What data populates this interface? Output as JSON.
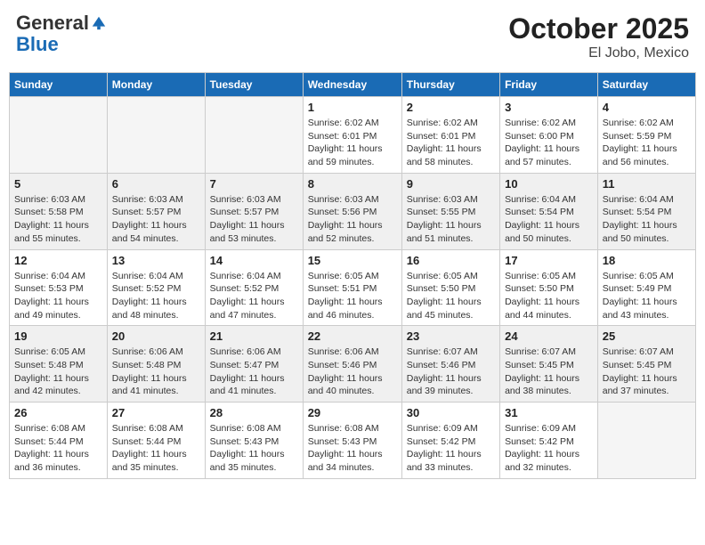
{
  "header": {
    "logo_general": "General",
    "logo_blue": "Blue",
    "month": "October 2025",
    "location": "El Jobo, Mexico"
  },
  "days_of_week": [
    "Sunday",
    "Monday",
    "Tuesday",
    "Wednesday",
    "Thursday",
    "Friday",
    "Saturday"
  ],
  "weeks": [
    [
      {
        "day": "",
        "sunrise": "",
        "sunset": "",
        "daylight": "",
        "empty": true
      },
      {
        "day": "",
        "sunrise": "",
        "sunset": "",
        "daylight": "",
        "empty": true
      },
      {
        "day": "",
        "sunrise": "",
        "sunset": "",
        "daylight": "",
        "empty": true
      },
      {
        "day": "1",
        "sunrise": "Sunrise: 6:02 AM",
        "sunset": "Sunset: 6:01 PM",
        "daylight": "Daylight: 11 hours and 59 minutes.",
        "empty": false
      },
      {
        "day": "2",
        "sunrise": "Sunrise: 6:02 AM",
        "sunset": "Sunset: 6:01 PM",
        "daylight": "Daylight: 11 hours and 58 minutes.",
        "empty": false
      },
      {
        "day": "3",
        "sunrise": "Sunrise: 6:02 AM",
        "sunset": "Sunset: 6:00 PM",
        "daylight": "Daylight: 11 hours and 57 minutes.",
        "empty": false
      },
      {
        "day": "4",
        "sunrise": "Sunrise: 6:02 AM",
        "sunset": "Sunset: 5:59 PM",
        "daylight": "Daylight: 11 hours and 56 minutes.",
        "empty": false
      }
    ],
    [
      {
        "day": "5",
        "sunrise": "Sunrise: 6:03 AM",
        "sunset": "Sunset: 5:58 PM",
        "daylight": "Daylight: 11 hours and 55 minutes.",
        "empty": false
      },
      {
        "day": "6",
        "sunrise": "Sunrise: 6:03 AM",
        "sunset": "Sunset: 5:57 PM",
        "daylight": "Daylight: 11 hours and 54 minutes.",
        "empty": false
      },
      {
        "day": "7",
        "sunrise": "Sunrise: 6:03 AM",
        "sunset": "Sunset: 5:57 PM",
        "daylight": "Daylight: 11 hours and 53 minutes.",
        "empty": false
      },
      {
        "day": "8",
        "sunrise": "Sunrise: 6:03 AM",
        "sunset": "Sunset: 5:56 PM",
        "daylight": "Daylight: 11 hours and 52 minutes.",
        "empty": false
      },
      {
        "day": "9",
        "sunrise": "Sunrise: 6:03 AM",
        "sunset": "Sunset: 5:55 PM",
        "daylight": "Daylight: 11 hours and 51 minutes.",
        "empty": false
      },
      {
        "day": "10",
        "sunrise": "Sunrise: 6:04 AM",
        "sunset": "Sunset: 5:54 PM",
        "daylight": "Daylight: 11 hours and 50 minutes.",
        "empty": false
      },
      {
        "day": "11",
        "sunrise": "Sunrise: 6:04 AM",
        "sunset": "Sunset: 5:54 PM",
        "daylight": "Daylight: 11 hours and 50 minutes.",
        "empty": false
      }
    ],
    [
      {
        "day": "12",
        "sunrise": "Sunrise: 6:04 AM",
        "sunset": "Sunset: 5:53 PM",
        "daylight": "Daylight: 11 hours and 49 minutes.",
        "empty": false
      },
      {
        "day": "13",
        "sunrise": "Sunrise: 6:04 AM",
        "sunset": "Sunset: 5:52 PM",
        "daylight": "Daylight: 11 hours and 48 minutes.",
        "empty": false
      },
      {
        "day": "14",
        "sunrise": "Sunrise: 6:04 AM",
        "sunset": "Sunset: 5:52 PM",
        "daylight": "Daylight: 11 hours and 47 minutes.",
        "empty": false
      },
      {
        "day": "15",
        "sunrise": "Sunrise: 6:05 AM",
        "sunset": "Sunset: 5:51 PM",
        "daylight": "Daylight: 11 hours and 46 minutes.",
        "empty": false
      },
      {
        "day": "16",
        "sunrise": "Sunrise: 6:05 AM",
        "sunset": "Sunset: 5:50 PM",
        "daylight": "Daylight: 11 hours and 45 minutes.",
        "empty": false
      },
      {
        "day": "17",
        "sunrise": "Sunrise: 6:05 AM",
        "sunset": "Sunset: 5:50 PM",
        "daylight": "Daylight: 11 hours and 44 minutes.",
        "empty": false
      },
      {
        "day": "18",
        "sunrise": "Sunrise: 6:05 AM",
        "sunset": "Sunset: 5:49 PM",
        "daylight": "Daylight: 11 hours and 43 minutes.",
        "empty": false
      }
    ],
    [
      {
        "day": "19",
        "sunrise": "Sunrise: 6:05 AM",
        "sunset": "Sunset: 5:48 PM",
        "daylight": "Daylight: 11 hours and 42 minutes.",
        "empty": false
      },
      {
        "day": "20",
        "sunrise": "Sunrise: 6:06 AM",
        "sunset": "Sunset: 5:48 PM",
        "daylight": "Daylight: 11 hours and 41 minutes.",
        "empty": false
      },
      {
        "day": "21",
        "sunrise": "Sunrise: 6:06 AM",
        "sunset": "Sunset: 5:47 PM",
        "daylight": "Daylight: 11 hours and 41 minutes.",
        "empty": false
      },
      {
        "day": "22",
        "sunrise": "Sunrise: 6:06 AM",
        "sunset": "Sunset: 5:46 PM",
        "daylight": "Daylight: 11 hours and 40 minutes.",
        "empty": false
      },
      {
        "day": "23",
        "sunrise": "Sunrise: 6:07 AM",
        "sunset": "Sunset: 5:46 PM",
        "daylight": "Daylight: 11 hours and 39 minutes.",
        "empty": false
      },
      {
        "day": "24",
        "sunrise": "Sunrise: 6:07 AM",
        "sunset": "Sunset: 5:45 PM",
        "daylight": "Daylight: 11 hours and 38 minutes.",
        "empty": false
      },
      {
        "day": "25",
        "sunrise": "Sunrise: 6:07 AM",
        "sunset": "Sunset: 5:45 PM",
        "daylight": "Daylight: 11 hours and 37 minutes.",
        "empty": false
      }
    ],
    [
      {
        "day": "26",
        "sunrise": "Sunrise: 6:08 AM",
        "sunset": "Sunset: 5:44 PM",
        "daylight": "Daylight: 11 hours and 36 minutes.",
        "empty": false
      },
      {
        "day": "27",
        "sunrise": "Sunrise: 6:08 AM",
        "sunset": "Sunset: 5:44 PM",
        "daylight": "Daylight: 11 hours and 35 minutes.",
        "empty": false
      },
      {
        "day": "28",
        "sunrise": "Sunrise: 6:08 AM",
        "sunset": "Sunset: 5:43 PM",
        "daylight": "Daylight: 11 hours and 35 minutes.",
        "empty": false
      },
      {
        "day": "29",
        "sunrise": "Sunrise: 6:08 AM",
        "sunset": "Sunset: 5:43 PM",
        "daylight": "Daylight: 11 hours and 34 minutes.",
        "empty": false
      },
      {
        "day": "30",
        "sunrise": "Sunrise: 6:09 AM",
        "sunset": "Sunset: 5:42 PM",
        "daylight": "Daylight: 11 hours and 33 minutes.",
        "empty": false
      },
      {
        "day": "31",
        "sunrise": "Sunrise: 6:09 AM",
        "sunset": "Sunset: 5:42 PM",
        "daylight": "Daylight: 11 hours and 32 minutes.",
        "empty": false
      },
      {
        "day": "",
        "sunrise": "",
        "sunset": "",
        "daylight": "",
        "empty": true
      }
    ]
  ]
}
